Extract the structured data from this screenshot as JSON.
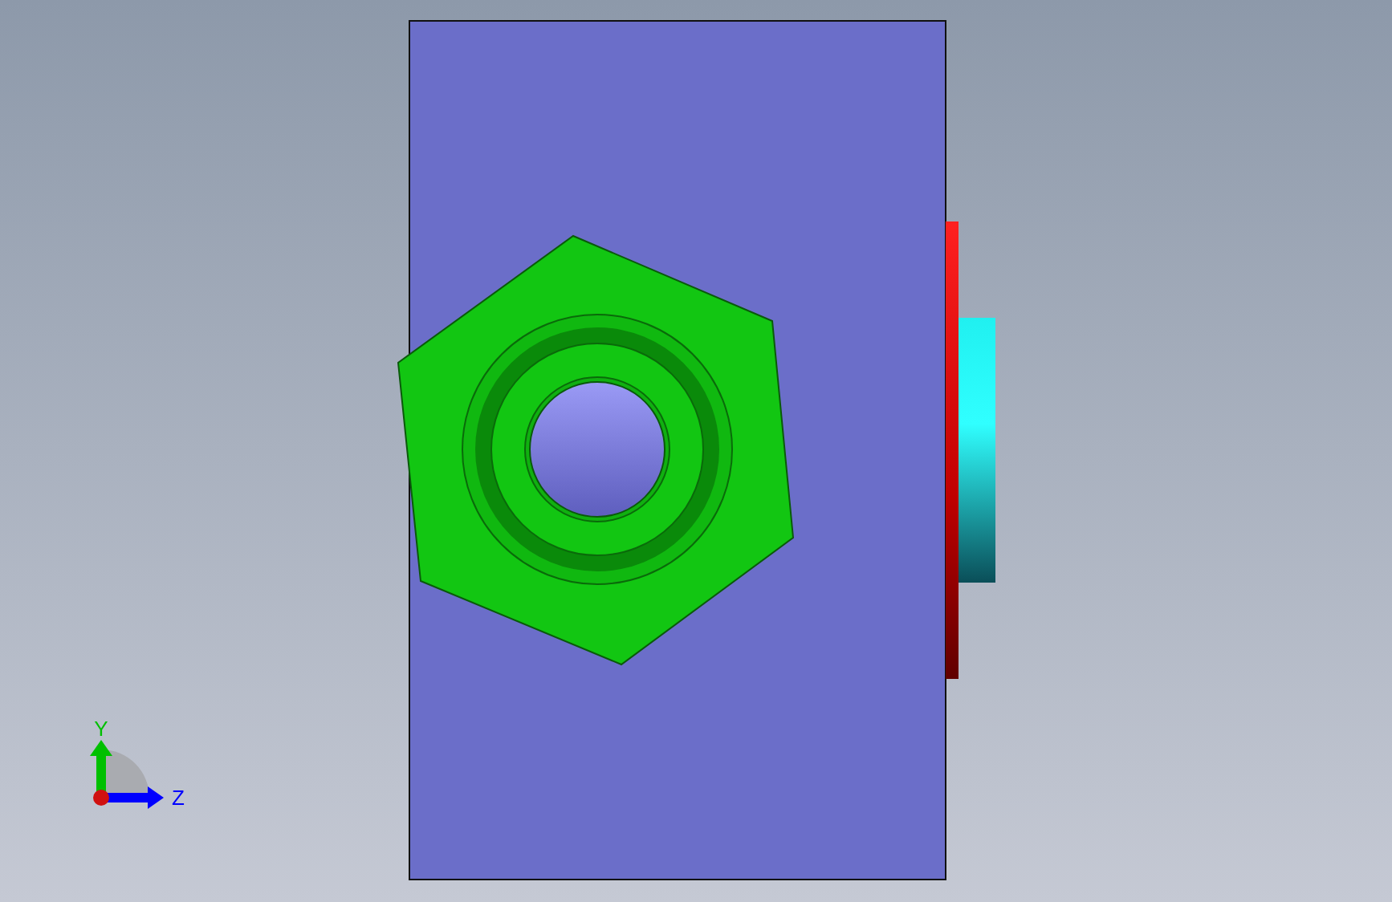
{
  "viewport": {
    "triad": {
      "axes": [
        {
          "kind": "vertical",
          "label": "Y",
          "color": "#00c000"
        },
        {
          "kind": "horizontal",
          "label": "Z",
          "color": "#0000ff"
        }
      ]
    }
  }
}
